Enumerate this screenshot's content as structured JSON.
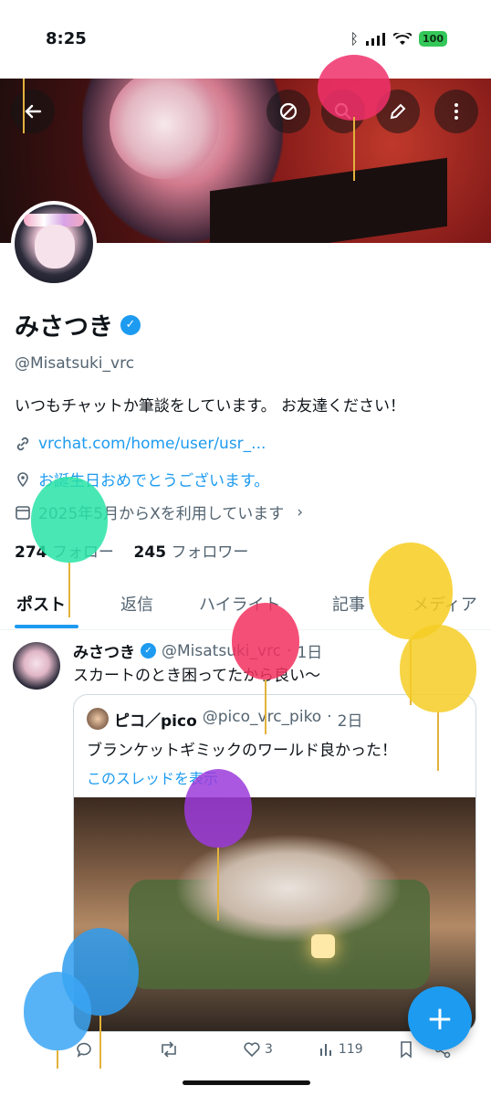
{
  "status_bar": {
    "time": "8:25",
    "battery": "100"
  },
  "profile": {
    "name": "みさつき",
    "handle": "@Misatsuki_vrc",
    "bio": "いつもチャットか筆談をしています。 お友達ください！",
    "link": "vrchat.com/home/user/usr_...",
    "location": "お誕生日おめでとうございます。",
    "joined": "2025年5月からXを利用しています",
    "following_count": "274",
    "following_label": "フォロー",
    "followers_count": "245",
    "followers_label": "フォロワー"
  },
  "tabs": [
    "ポスト",
    "返信",
    "ハイライト",
    "記事",
    "メディア"
  ],
  "post": {
    "author": "みさつき",
    "handle": "@Misatsuki_vrc",
    "time": "1日",
    "text": "スカートのとき困ってたから良い〜",
    "quote": {
      "author": "ピコ／pico",
      "handle": "@pico_vrc_piko",
      "time": "2日",
      "text": "ブランケットギミックのワールド良かった！",
      "thread_link": "このスレッドを表示"
    },
    "likes": "3",
    "views": "119"
  },
  "icons": {
    "back": "back-arrow-icon",
    "no_sign": "no-sign-icon",
    "search": "search-icon",
    "edit": "pencil-icon",
    "more": "more-vertical-icon",
    "compose": "plus-icon"
  },
  "colors": {
    "accent": "#1d9bf0",
    "text": "#0f1419",
    "muted": "#536471"
  }
}
